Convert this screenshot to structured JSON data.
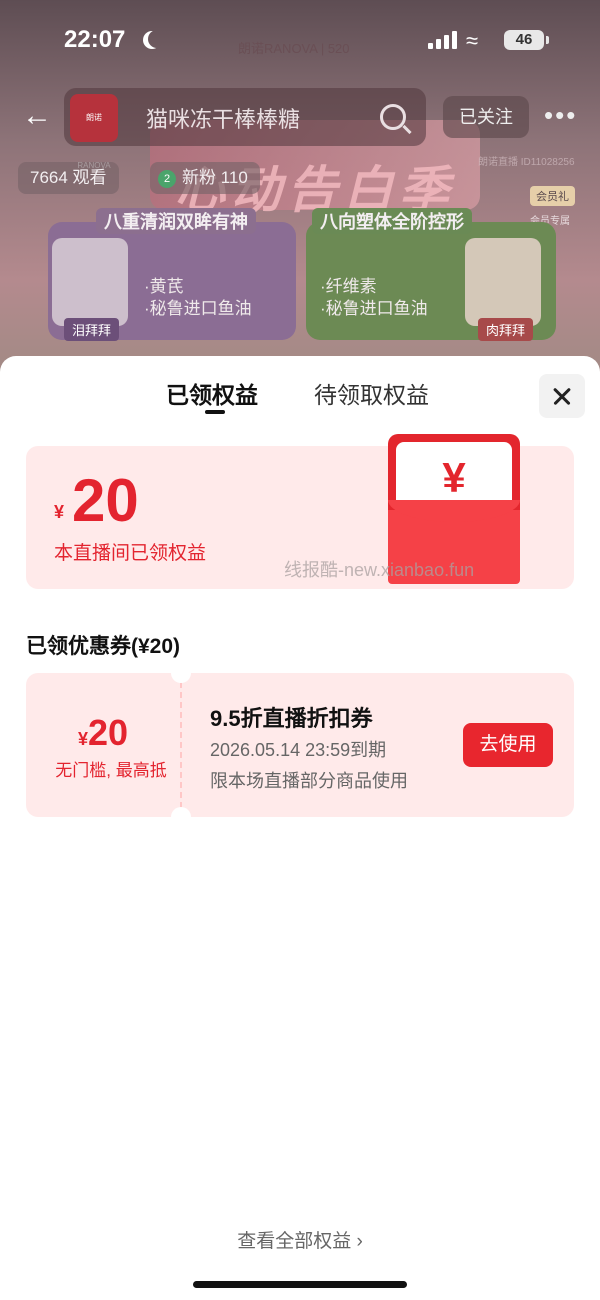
{
  "status_bar": {
    "time": "22:07",
    "battery": "46"
  },
  "header": {
    "room_title": "猫咪冻干棒棒糖",
    "avatar_text": "朗诺RANOVA",
    "follow_label": "已关注",
    "viewers": "7664 观看",
    "fans_level": "2",
    "fans_label": "新粉 110"
  },
  "background": {
    "logo_text": "朗诺RANOVA | 520",
    "banner_text": "心动告白季",
    "watermark_top": "朗诺直播 ID11028256",
    "member_tag": "会员礼",
    "member_tag2": "会员专属",
    "left_panel": {
      "title": "八重清润双眸有神",
      "line1": "·黄芪",
      "line2": "·秘鲁进口鱼油",
      "jar_label": "泪拜拜"
    },
    "right_panel": {
      "title": "八向塑体全阶控形",
      "line1": "·纤维素",
      "line2": "·秘鲁进口鱼油",
      "jar_label": "肉拜拜"
    }
  },
  "sheet": {
    "tabs": [
      {
        "label": "已领权益",
        "active": true
      },
      {
        "label": "待领取权益",
        "active": false
      }
    ],
    "summary": {
      "currency": "¥",
      "amount": "20",
      "description": "本直播间已领权益",
      "envelope_symbol": "¥"
    },
    "watermark": "线报酷-new.xianbao.fun",
    "section_title": "已领优惠券(¥20)",
    "coupon": {
      "currency": "¥",
      "amount": "20",
      "condition": "无门槛, 最高抵",
      "title": "9.5折直播折扣券",
      "expire": "2026.05.14  23:59到期",
      "scope": "限本场直播部分商品使用",
      "use_label": "去使用"
    },
    "view_all": "查看全部权益 ›"
  },
  "colors": {
    "accent": "#e3242f",
    "coupon_bg": "#ffeaea",
    "sheet_bg": "#ffffff"
  }
}
